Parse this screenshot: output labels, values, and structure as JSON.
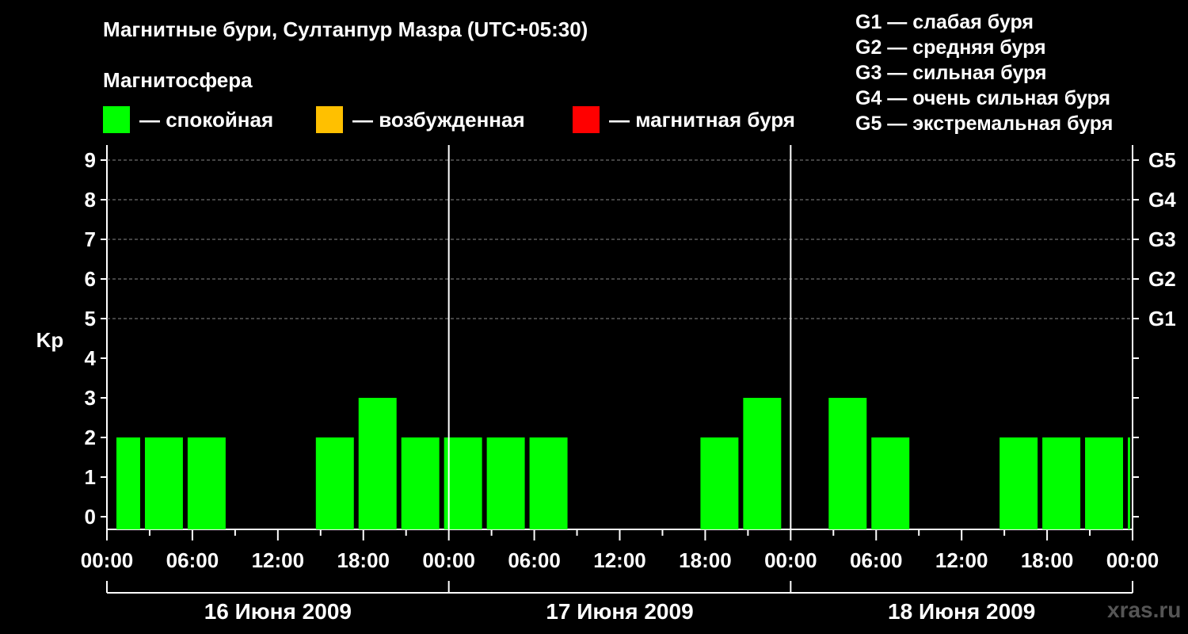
{
  "title": "Магнитные бури, Султанпур Мазра (UTC+05:30)",
  "magnetosphere": {
    "title": "Магнитосфера",
    "legend": [
      {
        "label": "— спокойная",
        "color": "#00ff00"
      },
      {
        "label": "— возбужденная",
        "color": "#ffc000"
      },
      {
        "label": "— магнитная буря",
        "color": "#ff0000"
      }
    ]
  },
  "storm_scale": [
    "G1 — слабая буря",
    "G2 — средняя буря",
    "G3 — сильная буря",
    "G4 — очень сильная буря",
    "G5 — экстремальная буря"
  ],
  "watermark": "xras.ru",
  "chart_data": {
    "type": "bar",
    "ylabel": "Kp",
    "ylim": [
      0,
      9
    ],
    "yticks": [
      0,
      1,
      2,
      3,
      4,
      5,
      6,
      7,
      8,
      9
    ],
    "right_axis_labels": [
      {
        "kp": 5,
        "label": "G1"
      },
      {
        "kp": 6,
        "label": "G2"
      },
      {
        "kp": 7,
        "label": "G3"
      },
      {
        "kp": 8,
        "label": "G4"
      },
      {
        "kp": 9,
        "label": "G5"
      }
    ],
    "xtick_labels": [
      "00:00",
      "06:00",
      "12:00",
      "18:00",
      "00:00",
      "06:00",
      "12:00",
      "18:00",
      "00:00",
      "06:00",
      "12:00",
      "18:00",
      "00:00"
    ],
    "days": [
      "16 Июня 2009",
      "17 Июня 2009",
      "18 Июня 2009"
    ],
    "grid": true,
    "series": [
      {
        "color": "#00ff00",
        "bars": [
          {
            "start": "2009-06-16 00:30",
            "end": "2009-06-16 02:30",
            "value": 1
          },
          {
            "start": "2009-06-16 02:30",
            "end": "2009-06-16 05:30",
            "value": 1
          },
          {
            "start": "2009-06-16 05:30",
            "end": "2009-06-16 08:30",
            "value": 1
          },
          {
            "start": "2009-06-16 14:30",
            "end": "2009-06-16 17:30",
            "value": 1
          },
          {
            "start": "2009-06-16 17:30",
            "end": "2009-06-16 20:30",
            "value": 2
          },
          {
            "start": "2009-06-16 20:30",
            "end": "2009-06-16 23:30",
            "value": 1
          },
          {
            "start": "2009-06-16 23:30",
            "end": "2009-06-17 02:30",
            "value": 1
          },
          {
            "start": "2009-06-17 02:30",
            "end": "2009-06-17 05:30",
            "value": 1
          },
          {
            "start": "2009-06-17 05:30",
            "end": "2009-06-17 08:30",
            "value": 1
          },
          {
            "start": "2009-06-17 17:30",
            "end": "2009-06-17 20:30",
            "value": 1
          },
          {
            "start": "2009-06-17 20:30",
            "end": "2009-06-17 23:30",
            "value": 2
          },
          {
            "start": "2009-06-18 02:30",
            "end": "2009-06-18 05:30",
            "value": 2
          },
          {
            "start": "2009-06-18 05:30",
            "end": "2009-06-18 08:30",
            "value": 1
          },
          {
            "start": "2009-06-18 14:30",
            "end": "2009-06-18 17:30",
            "value": 1
          },
          {
            "start": "2009-06-18 17:30",
            "end": "2009-06-18 20:30",
            "value": 1
          },
          {
            "start": "2009-06-18 20:30",
            "end": "2009-06-18 23:30",
            "value": 1
          },
          {
            "start": "2009-06-18 23:30",
            "end": "2009-06-19 00:00",
            "value": 1
          }
        ]
      }
    ]
  }
}
